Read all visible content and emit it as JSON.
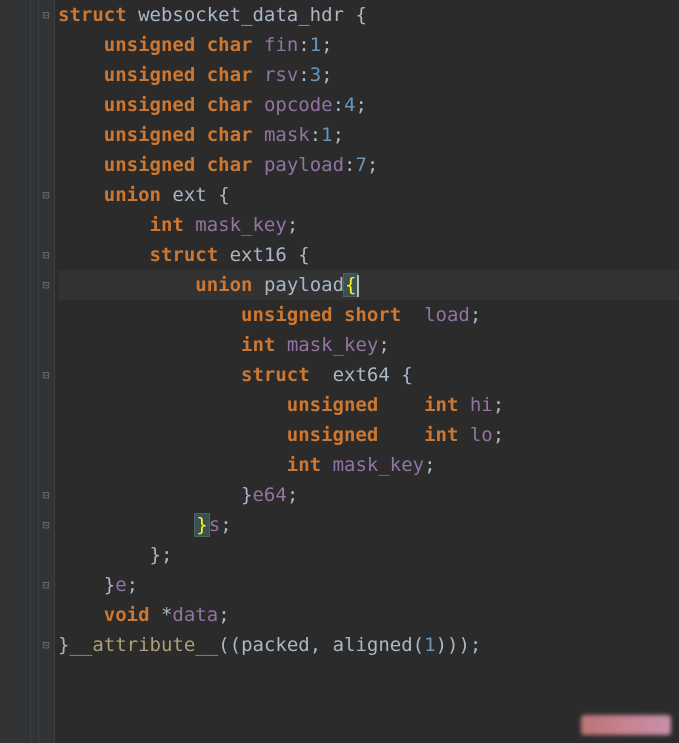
{
  "lang": "c",
  "current_line_index": 10,
  "code": {
    "lines": [
      {
        "indent": 0,
        "fold": "open",
        "tokens": [
          {
            "t": "struct",
            "c": "kw-b"
          },
          {
            "t": " ",
            "c": ""
          },
          {
            "t": "websocket_data_hdr",
            "c": "ident"
          },
          {
            "t": " {",
            "c": "brace"
          }
        ]
      },
      {
        "indent": 1,
        "tokens": [
          {
            "t": "unsigned char",
            "c": "kw-b"
          },
          {
            "t": " ",
            "c": ""
          },
          {
            "t": "fin",
            "c": "member"
          },
          {
            "t": ":",
            "c": "punct"
          },
          {
            "t": "1",
            "c": "num"
          },
          {
            "t": ";",
            "c": "punct"
          }
        ]
      },
      {
        "indent": 1,
        "tokens": [
          {
            "t": "unsigned char",
            "c": "kw-b"
          },
          {
            "t": " ",
            "c": ""
          },
          {
            "t": "rsv",
            "c": "member"
          },
          {
            "t": ":",
            "c": "punct"
          },
          {
            "t": "3",
            "c": "num"
          },
          {
            "t": ";",
            "c": "punct"
          }
        ]
      },
      {
        "indent": 1,
        "tokens": [
          {
            "t": "unsigned char",
            "c": "kw-b"
          },
          {
            "t": " ",
            "c": ""
          },
          {
            "t": "opcode",
            "c": "member"
          },
          {
            "t": ":",
            "c": "punct"
          },
          {
            "t": "4",
            "c": "num"
          },
          {
            "t": ";",
            "c": "punct"
          }
        ]
      },
      {
        "indent": 1,
        "tokens": [
          {
            "t": "unsigned char",
            "c": "kw-b"
          },
          {
            "t": " ",
            "c": ""
          },
          {
            "t": "mask",
            "c": "member"
          },
          {
            "t": ":",
            "c": "punct"
          },
          {
            "t": "1",
            "c": "num"
          },
          {
            "t": ";",
            "c": "punct"
          }
        ]
      },
      {
        "indent": 1,
        "tokens": [
          {
            "t": "unsigned char",
            "c": "kw-b"
          },
          {
            "t": " ",
            "c": ""
          },
          {
            "t": "payload",
            "c": "member"
          },
          {
            "t": ":",
            "c": "punct"
          },
          {
            "t": "7",
            "c": "num"
          },
          {
            "t": ";",
            "c": "punct"
          }
        ]
      },
      {
        "indent": 1,
        "fold": "open",
        "tokens": [
          {
            "t": "union",
            "c": "kw-b"
          },
          {
            "t": " ",
            "c": ""
          },
          {
            "t": "ext",
            "c": "ident"
          },
          {
            "t": " {",
            "c": "brace"
          }
        ]
      },
      {
        "indent": 2,
        "tokens": [
          {
            "t": "int",
            "c": "kw-b"
          },
          {
            "t": " ",
            "c": ""
          },
          {
            "t": "mask_key",
            "c": "member"
          },
          {
            "t": ";",
            "c": "punct"
          }
        ]
      },
      {
        "indent": 2,
        "fold": "open",
        "tokens": [
          {
            "t": "struct",
            "c": "kw-b"
          },
          {
            "t": " ",
            "c": ""
          },
          {
            "t": "ext16",
            "c": "ident"
          },
          {
            "t": " {",
            "c": "brace"
          }
        ]
      },
      {
        "indent": 3,
        "fold": "open",
        "current": true,
        "tokens": [
          {
            "t": "union",
            "c": "kw-b"
          },
          {
            "t": " ",
            "c": ""
          },
          {
            "t": "payload",
            "c": "ident"
          },
          {
            "t": "{",
            "c": "brace-match"
          }
        ],
        "caret_after": true
      },
      {
        "indent": 4,
        "tokens": [
          {
            "t": "unsigned short",
            "c": "kw-b"
          },
          {
            "t": "  ",
            "c": ""
          },
          {
            "t": "load",
            "c": "member"
          },
          {
            "t": ";",
            "c": "punct"
          }
        ]
      },
      {
        "indent": 4,
        "tokens": [
          {
            "t": "int",
            "c": "kw-b"
          },
          {
            "t": " ",
            "c": ""
          },
          {
            "t": "mask_key",
            "c": "member"
          },
          {
            "t": ";",
            "c": "punct"
          }
        ]
      },
      {
        "indent": 4,
        "fold": "open",
        "tokens": [
          {
            "t": "struct",
            "c": "kw-b"
          },
          {
            "t": "  ",
            "c": ""
          },
          {
            "t": "ext64",
            "c": "ident"
          },
          {
            "t": " {",
            "c": "brace"
          }
        ]
      },
      {
        "indent": 5,
        "tokens": [
          {
            "t": "unsigned",
            "c": "kw-b"
          },
          {
            "t": "    ",
            "c": ""
          },
          {
            "t": "int",
            "c": "kw-b"
          },
          {
            "t": " ",
            "c": ""
          },
          {
            "t": "hi",
            "c": "member"
          },
          {
            "t": ";",
            "c": "punct"
          }
        ]
      },
      {
        "indent": 5,
        "tokens": [
          {
            "t": "unsigned",
            "c": "kw-b"
          },
          {
            "t": "    ",
            "c": ""
          },
          {
            "t": "int",
            "c": "kw-b"
          },
          {
            "t": " ",
            "c": ""
          },
          {
            "t": "lo",
            "c": "member"
          },
          {
            "t": ";",
            "c": "punct"
          }
        ]
      },
      {
        "indent": 5,
        "tokens": [
          {
            "t": "int",
            "c": "kw-b"
          },
          {
            "t": " ",
            "c": ""
          },
          {
            "t": "mask_key",
            "c": "member"
          },
          {
            "t": ";",
            "c": "punct"
          }
        ]
      },
      {
        "indent": 4,
        "fold": "close",
        "tokens": [
          {
            "t": "}",
            "c": "brace"
          },
          {
            "t": "e64",
            "c": "member"
          },
          {
            "t": ";",
            "c": "punct"
          }
        ]
      },
      {
        "indent": 3,
        "fold": "close",
        "tokens": [
          {
            "t": "}",
            "c": "brace-match"
          },
          {
            "t": "s",
            "c": "member"
          },
          {
            "t": ";",
            "c": "punct"
          }
        ]
      },
      {
        "indent": 2,
        "tokens": [
          {
            "t": "};",
            "c": "brace"
          }
        ]
      },
      {
        "indent": 1,
        "fold": "close",
        "tokens": [
          {
            "t": "}",
            "c": "brace"
          },
          {
            "t": "e",
            "c": "member"
          },
          {
            "t": ";",
            "c": "punct"
          }
        ]
      },
      {
        "indent": 1,
        "tokens": [
          {
            "t": "void",
            "c": "kw-b"
          },
          {
            "t": " *",
            "c": "star"
          },
          {
            "t": "data",
            "c": "member"
          },
          {
            "t": ";",
            "c": "punct"
          }
        ]
      },
      {
        "indent": 0,
        "fold": "close",
        "tokens": [
          {
            "t": "}",
            "c": "brace"
          },
          {
            "t": "__attribute__",
            "c": "type"
          },
          {
            "t": "((",
            "c": "paren"
          },
          {
            "t": "packed",
            "c": "ident"
          },
          {
            "t": ", ",
            "c": "punct"
          },
          {
            "t": "aligned",
            "c": "ident"
          },
          {
            "t": "(",
            "c": "paren"
          },
          {
            "t": "1",
            "c": "num"
          },
          {
            "t": ")));",
            "c": "paren"
          }
        ]
      }
    ]
  },
  "fold_icons": {
    "open": "⊟",
    "close": "⊟"
  },
  "indent_width": 4
}
